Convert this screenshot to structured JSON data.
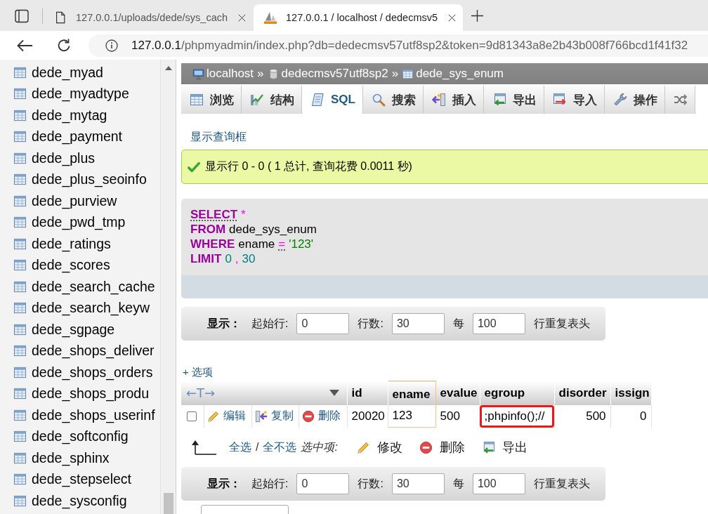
{
  "browser": {
    "tabs": [
      {
        "kind": "page",
        "title": "127.0.0.1/uploads/dede/sys_cach",
        "selected": false
      },
      {
        "kind": "app",
        "title": "127.0.0.1 / localhost / dedecmsv5",
        "selected": true
      }
    ],
    "url": {
      "host": "127.0.0.1",
      "path": "/phpmyadmin/index.php?db=dedecmsv57utf8sp2&token=9d81343a8e2b43b008f766bcd1f41f32"
    }
  },
  "sidebar": {
    "items": [
      {
        "label": "dede_myad"
      },
      {
        "label": "dede_myadtype"
      },
      {
        "label": "dede_mytag"
      },
      {
        "label": "dede_payment"
      },
      {
        "label": "dede_plus"
      },
      {
        "label": "dede_plus_seoinfo"
      },
      {
        "label": "dede_purview"
      },
      {
        "label": "dede_pwd_tmp"
      },
      {
        "label": "dede_ratings"
      },
      {
        "label": "dede_scores"
      },
      {
        "label": "dede_search_cache"
      },
      {
        "label": "dede_search_keyw"
      },
      {
        "label": "dede_sgpage"
      },
      {
        "label": "dede_shops_deliver"
      },
      {
        "label": "dede_shops_orders"
      },
      {
        "label": "dede_shops_produ"
      },
      {
        "label": "dede_shops_userinf"
      },
      {
        "label": "dede_softconfig"
      },
      {
        "label": "dede_sphinx"
      },
      {
        "label": "dede_stepselect"
      },
      {
        "label": "dede_sysconfig"
      }
    ]
  },
  "breadcrumb": [
    {
      "kind": "server",
      "label": "localhost"
    },
    {
      "kind": "separator",
      "label": "»"
    },
    {
      "kind": "database",
      "label": "dedecmsv57utf8sp2"
    },
    {
      "kind": "separator",
      "label": "»"
    },
    {
      "kind": "table",
      "label": "dede_sys_enum"
    }
  ],
  "tabs": [
    {
      "kind": "browse",
      "label": "浏览",
      "selected": false
    },
    {
      "kind": "structure",
      "label": "结构",
      "selected": false
    },
    {
      "kind": "sql",
      "label": "SQL",
      "selected": true
    },
    {
      "kind": "search",
      "label": "搜索",
      "selected": false
    },
    {
      "kind": "insert",
      "label": "插入",
      "selected": false
    },
    {
      "kind": "export",
      "label": "导出",
      "selected": false
    },
    {
      "kind": "import",
      "label": "导入",
      "selected": false
    },
    {
      "kind": "operations",
      "label": "操作",
      "selected": false
    },
    {
      "kind": "tracking",
      "selected": false
    }
  ],
  "query_toggle": "显示查询框",
  "message": {
    "kind": "success",
    "text": "显示行 0 - 0 ( 1 总计, 查询花费 0.0011 秒)"
  },
  "sql": {
    "lines": [
      {
        "tokens": [
          {
            "kind": "keyword",
            "text": "SELECT",
            "doc_link": true
          },
          {
            "kind": "operator",
            "text": "*",
            "doc_link": false
          }
        ]
      },
      {
        "tokens": [
          {
            "kind": "keyword",
            "text": "FROM",
            "doc_link": false
          },
          {
            "kind": "identifier",
            "text": "dede_sys_enum",
            "doc_link": false
          }
        ]
      },
      {
        "tokens": [
          {
            "kind": "keyword",
            "text": "WHERE",
            "doc_link": false
          },
          {
            "kind": "identifier",
            "text": "ename",
            "doc_link": false
          },
          {
            "kind": "operator",
            "text": "=",
            "doc_link": true
          },
          {
            "kind": "string",
            "text": "'123'",
            "doc_link": false
          }
        ]
      },
      {
        "tokens": [
          {
            "kind": "keyword",
            "text": "LIMIT",
            "doc_link": false
          },
          {
            "kind": "number",
            "text": "0",
            "doc_link": false
          },
          {
            "kind": "operator",
            "text": ",",
            "doc_link": false
          },
          {
            "kind": "number",
            "text": "30",
            "doc_link": false
          }
        ]
      }
    ]
  },
  "nav_bars": [
    {
      "heading": "显示：",
      "start_label": "起始行:",
      "start": "0",
      "rows_label": "行数:",
      "rows": "30",
      "per_label": "每",
      "per": "100",
      "suffix": "行重复表头"
    },
    {
      "heading": "显示：",
      "start_label": "起始行:",
      "start": "0",
      "rows_label": "行数:",
      "rows": "30",
      "per_label": "每",
      "per": "100",
      "suffix": "行重复表头"
    }
  ],
  "options_link": "+ 选项",
  "table": {
    "text_toggle": "←T→",
    "columns": [
      {
        "label": "id",
        "marked": false
      },
      {
        "label": "ename",
        "marked": true
      },
      {
        "label": "evalue",
        "marked": false
      },
      {
        "label": "egroup",
        "marked": false
      },
      {
        "label": "disorder",
        "marked": false
      },
      {
        "label": "issign",
        "marked": false
      }
    ],
    "rows": [
      {
        "checked": false,
        "actions": [
          {
            "kind": "edit",
            "label": "编辑"
          },
          {
            "kind": "copy",
            "label": "复制"
          },
          {
            "kind": "delete",
            "label": "删除"
          }
        ],
        "cells": [
          {
            "text": "20020",
            "circled": false
          },
          {
            "text": "123",
            "circled": false
          },
          {
            "text": "500",
            "circled": false
          },
          {
            "text": ";phpinfo();//",
            "circled": true
          },
          {
            "text": "500",
            "circled": false
          },
          {
            "text": "0",
            "circled": false
          }
        ]
      }
    ]
  },
  "bulk_actions": {
    "select_all": "全选",
    "separator": "/",
    "deselect_all": "全不选",
    "with_selected": "选中项:",
    "actions": [
      {
        "kind": "edit",
        "label": "修改"
      },
      {
        "kind": "delete",
        "label": "删除"
      },
      {
        "kind": "export",
        "label": "导出"
      }
    ]
  }
}
